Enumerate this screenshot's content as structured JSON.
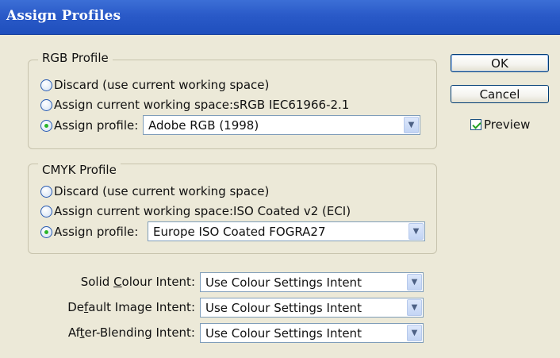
{
  "window": {
    "title": "Assign Profiles"
  },
  "rgb": {
    "label": "RGB Profile",
    "options": [
      {
        "label": "Discard (use current working space)",
        "checked": false
      },
      {
        "label": "Assign current working space:sRGB IEC61966-2.1",
        "checked": false
      },
      {
        "label": "Assign profile:",
        "checked": true
      }
    ],
    "profile": "Adobe RGB (1998)"
  },
  "cmyk": {
    "label": "CMYK Profile",
    "options": [
      {
        "label": "Discard (use current working space)",
        "checked": false
      },
      {
        "label": "Assign current working space:ISO Coated v2 (ECI)",
        "checked": false
      },
      {
        "label": "Assign profile:",
        "checked": true
      }
    ],
    "profile": "Europe ISO Coated FOGRA27"
  },
  "intents": [
    {
      "pre": "Solid ",
      "key": "C",
      "post": "olour Intent:",
      "value": "Use Colour Settings Intent"
    },
    {
      "pre": "De",
      "key": "f",
      "post": "ault Image Intent:",
      "value": "Use Colour Settings Intent"
    },
    {
      "pre": "Af",
      "key": "t",
      "post": "er-Blending Intent:",
      "value": "Use Colour Settings Intent"
    }
  ],
  "buttons": {
    "ok": "OK",
    "cancel": "Cancel"
  },
  "preview": {
    "label": "Preview",
    "checked": true
  },
  "icons": {
    "dropdown": "chevron-down-icon"
  }
}
